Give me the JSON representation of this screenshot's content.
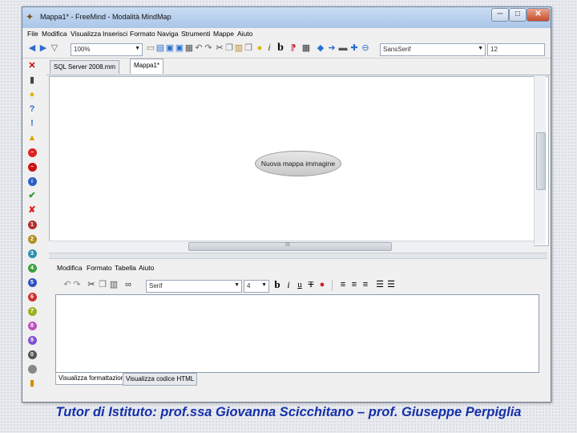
{
  "window": {
    "title": "Mappa1* - FreeMind - Modalità MindMap",
    "buttons": {
      "minimize": "─",
      "maximize": "□",
      "close": "✕"
    }
  },
  "menubar": [
    "File",
    "Modifica",
    "Visualizza",
    "Inserisci",
    "Formato",
    "Naviga",
    "Strumenti",
    "Mappe",
    "Aiuto"
  ],
  "toolbar": {
    "zoom_value": "100%",
    "font_family": "SansSerif",
    "font_size": "12",
    "bold_label": "b",
    "italic_label": "i"
  },
  "document_tabs": [
    {
      "label": "SQL Server 2008.mm",
      "active": false
    },
    {
      "label": "Mappa1*",
      "active": true
    }
  ],
  "map": {
    "root_node_text": "Nuova mappa immagine",
    "hscroll_marker": "III"
  },
  "notes_editor": {
    "menu": [
      "Modifica",
      "Formato",
      "Tabella",
      "Aiuto"
    ],
    "font_family": "Serif",
    "font_size": "4",
    "bold_label": "b",
    "italic_label": "i",
    "underline_label": "u",
    "strike_label": "T",
    "tabs": [
      {
        "label": "Visualizza formattazione",
        "active": true
      },
      {
        "label": "Visualizza codice HTML",
        "active": false
      }
    ]
  },
  "footer": {
    "text": "Tutor di Istituto: prof.ssa Giovanna Scicchitano – prof. Giuseppe Perpiglia"
  },
  "colors": {
    "footer_text": "#1530a8",
    "titlebar": "#aac6e9",
    "node_fill": "#d6d6d6"
  },
  "icons": {
    "palette": [
      "remove-icon",
      "trash-icon",
      "idea-icon",
      "question-icon",
      "important-icon",
      "warning-icon",
      "stop-icon",
      "stop-sign-icon",
      "info-icon",
      "check-icon",
      "cross-icon",
      "priority-1-icon",
      "priority-2-icon",
      "priority-3-icon",
      "priority-4-icon",
      "priority-5-icon",
      "priority-6-icon",
      "priority-7-icon",
      "priority-8-icon",
      "priority-9-icon",
      "priority-0-icon",
      "battery-icon"
    ]
  }
}
